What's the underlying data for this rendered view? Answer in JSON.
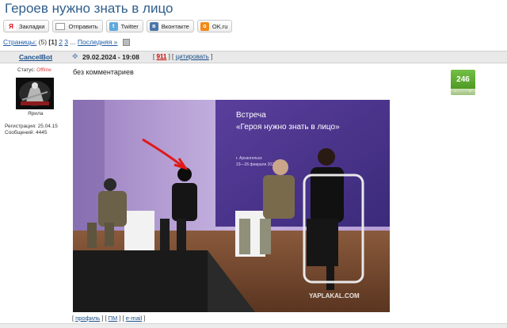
{
  "page": {
    "title": "Героев нужно знать в лицо"
  },
  "share": {
    "bookmarks": "Закладки",
    "send": "Отправить",
    "twitter": "Twitter",
    "vk": "Вконтакте",
    "ok": "OK.ru"
  },
  "pagination": {
    "label": "Страницы:",
    "count": "(5)",
    "current": "[1]",
    "p2": "2",
    "p3": "3",
    "ellipsis": "...",
    "last": "Последняя »"
  },
  "post": {
    "author": "CancelBot",
    "date": "29.02.2024 - 19:08",
    "number": "911",
    "quote": "цитировать",
    "status_label": "Статус:",
    "status_value": "Offline",
    "avatar_label": "Ярила",
    "registration": "Регистрация: 25.04.15",
    "messages": "Сообщений: 4445",
    "comment": "без комментариев",
    "score": "246",
    "vote_minus": "−",
    "vote_plus": "+",
    "screen_title_line1": "Встреча",
    "screen_title_line2": "«Героя нужно знать в лицо»",
    "screen_city": "г. Архангельск",
    "screen_dates": "23—26 февраля 2024 года",
    "watermark": "YAPLAKAL.COM"
  },
  "footer": {
    "profile": "профиль",
    "pm": "ПМ",
    "email": "e-mail"
  },
  "colors": {
    "title": "#2f5e8c",
    "link": "#1a4f8a",
    "score_bg": "#5aa62f",
    "offline": "#e03c3c"
  }
}
